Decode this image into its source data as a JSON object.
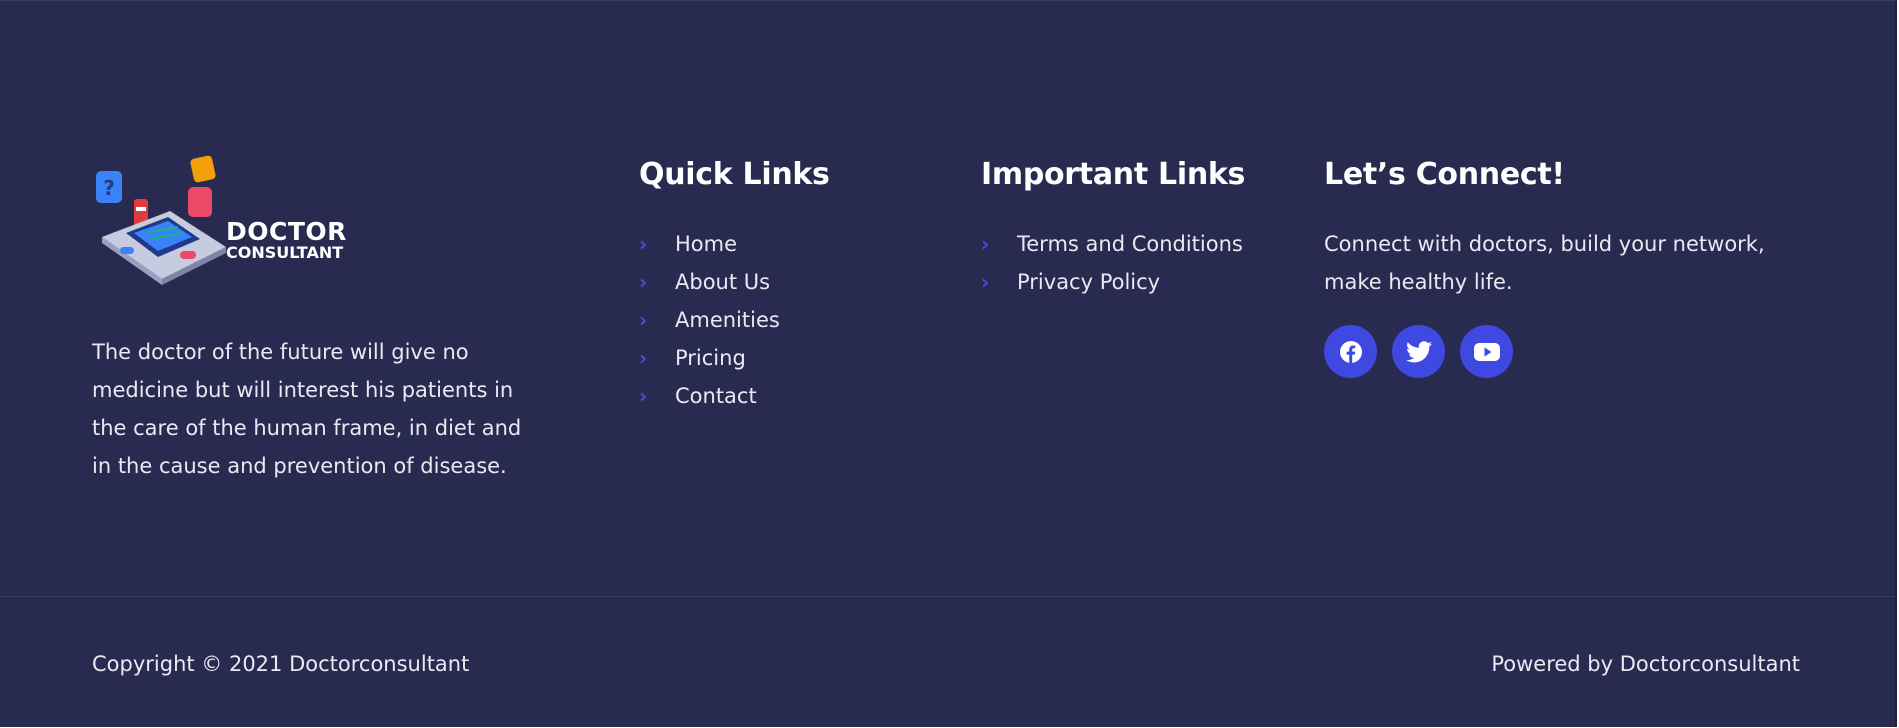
{
  "brand": {
    "logo_line1": "DOCTOR",
    "logo_line2": "CONSULTANT",
    "description": "The doctor of the future will give no medicine but will interest his patients in the care of the human frame, in diet and in the cause and prevention of disease."
  },
  "quick_links": {
    "title": "Quick Links",
    "items": [
      "Home",
      "About Us",
      "Amenities",
      "Pricing",
      "Contact"
    ]
  },
  "important_links": {
    "title": "Important Links",
    "items": [
      "Terms and Conditions",
      "Privacy Policy"
    ]
  },
  "connect": {
    "title": "Let’s Connect!",
    "text": "Connect with doctors, build your network, make healthy life.",
    "socials": [
      "facebook-icon",
      "twitter-icon",
      "youtube-icon"
    ]
  },
  "bottom": {
    "copyright": "Copyright © 2021 Doctorconsultant",
    "powered": "Powered by Doctorconsultant"
  },
  "colors": {
    "background": "#282b4f",
    "accent": "#3f48e0",
    "text": "#e8e9f2"
  }
}
